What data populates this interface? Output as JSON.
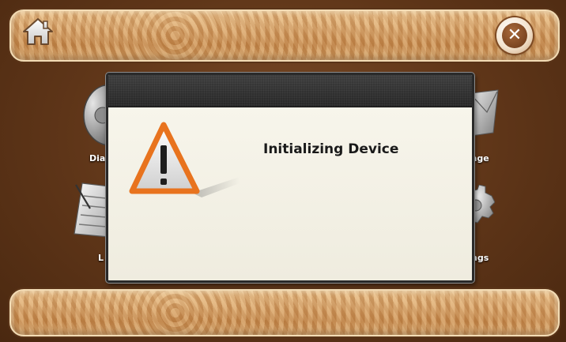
{
  "topbar": {
    "home_icon": "home-icon",
    "close_icon": "close-icon",
    "close_glyph": "✕"
  },
  "menu": {
    "items": [
      {
        "label": "Dia",
        "icon": "phone-icon"
      },
      {
        "label": "age",
        "icon": "message-envelope-icon"
      },
      {
        "label": "L",
        "icon": "log-notepad-icon"
      },
      {
        "label": "ngs",
        "icon": "settings-gear-icon"
      }
    ]
  },
  "dialog": {
    "icon": "warning-icon",
    "message": "Initializing Device"
  },
  "colors": {
    "background": "#5e3518",
    "bar": "#d39b5f",
    "dialog_header": "#2f2f2f",
    "dialog_body": "#f3f0e3",
    "warning_orange": "#e8731e"
  }
}
